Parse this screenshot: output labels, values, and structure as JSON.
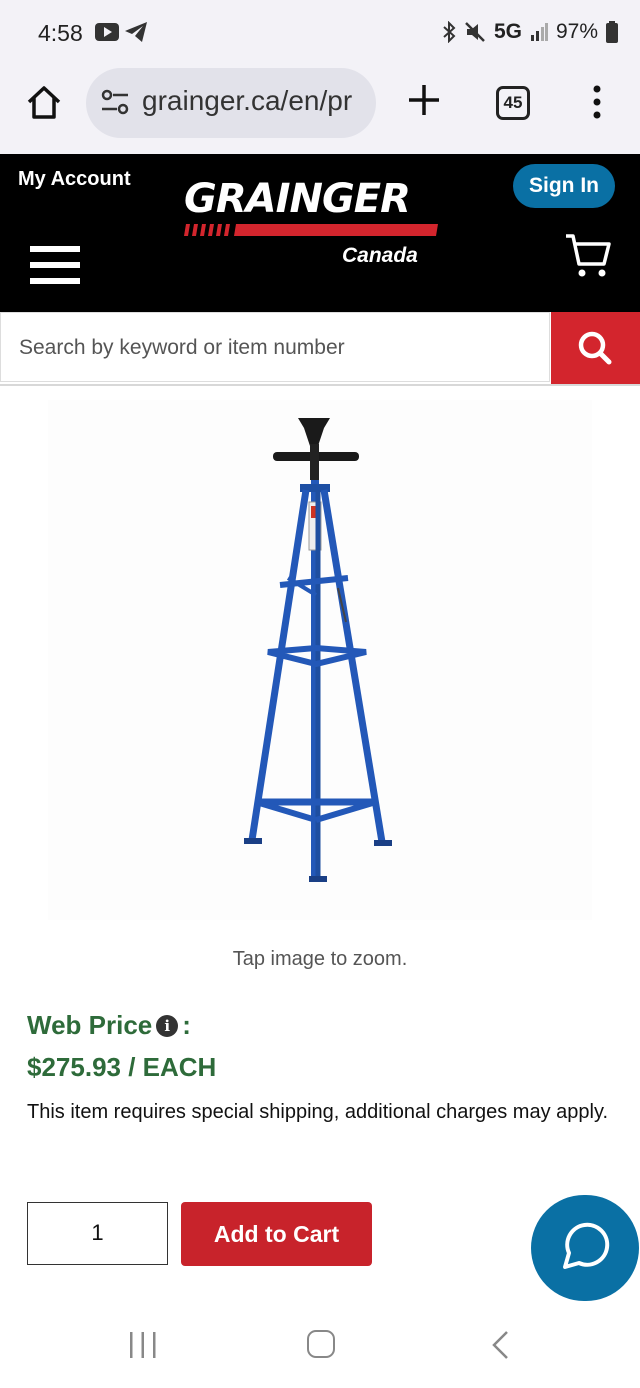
{
  "status_bar": {
    "time": "4:58",
    "network": "5G",
    "battery": "97%",
    "icons": [
      "youtube-icon",
      "telegram-icon",
      "bluetooth-icon",
      "mute-icon",
      "signal-icon",
      "battery-icon"
    ]
  },
  "browser": {
    "url": "grainger.ca/en/pr",
    "tab_count": "45"
  },
  "header": {
    "my_account": "My Account",
    "logo_text": "GRAINGER",
    "logo_subtext": "Canada",
    "sign_in": "Sign In"
  },
  "search": {
    "placeholder": "Search by keyword or item number"
  },
  "product": {
    "zoom_hint": "Tap image to zoom.",
    "web_price_label": "Web Price",
    "colon": ":",
    "price": "$275.93 / EACH",
    "shipping_note": "This item requires special shipping, additional charges may apply.",
    "quantity": "1",
    "add_to_cart": "Add to Cart"
  },
  "colors": {
    "brand_red": "#d3252d",
    "sign_in_blue": "#0a70a4",
    "price_green": "#2e6b3a",
    "stand_blue": "#2358b8"
  }
}
